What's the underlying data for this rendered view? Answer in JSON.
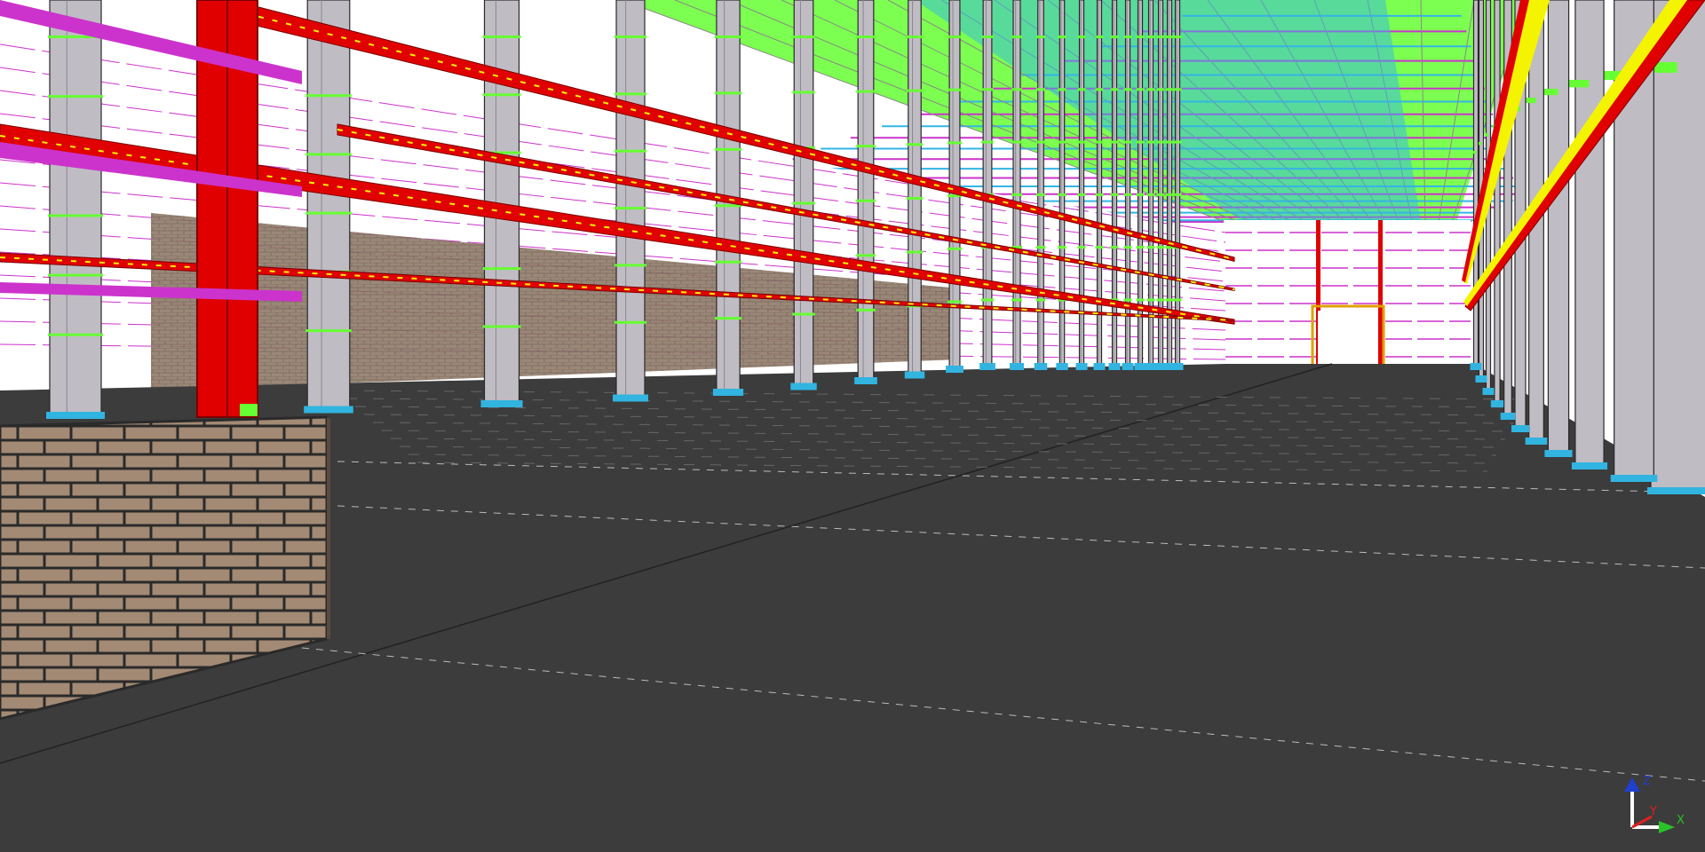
{
  "viewport": {
    "background": "#3c3c3c",
    "floor_color": "#3c3c3c",
    "sky_color": "#ffffff",
    "column_color": "#c0bcc4",
    "column_edge": "#2a2a2a",
    "base_plate_color": "#31b4e0",
    "beam_red": "#e00000",
    "beam_yellow": "#f4f400",
    "purlin_green": "#66ff33",
    "purlin_cyan": "#33b5e5",
    "bracing_magenta": "#cc33cc",
    "brick_color": "#a38a74",
    "mortar_color": "#2a2a2a"
  },
  "axis_triad": {
    "icon": "xyz-axis-triad-icon",
    "z_label": "Z",
    "x_label": "X",
    "y_label": "Y",
    "z_color": "#1f3fd0",
    "x_color": "#29c229",
    "y_color": "#e02020"
  }
}
